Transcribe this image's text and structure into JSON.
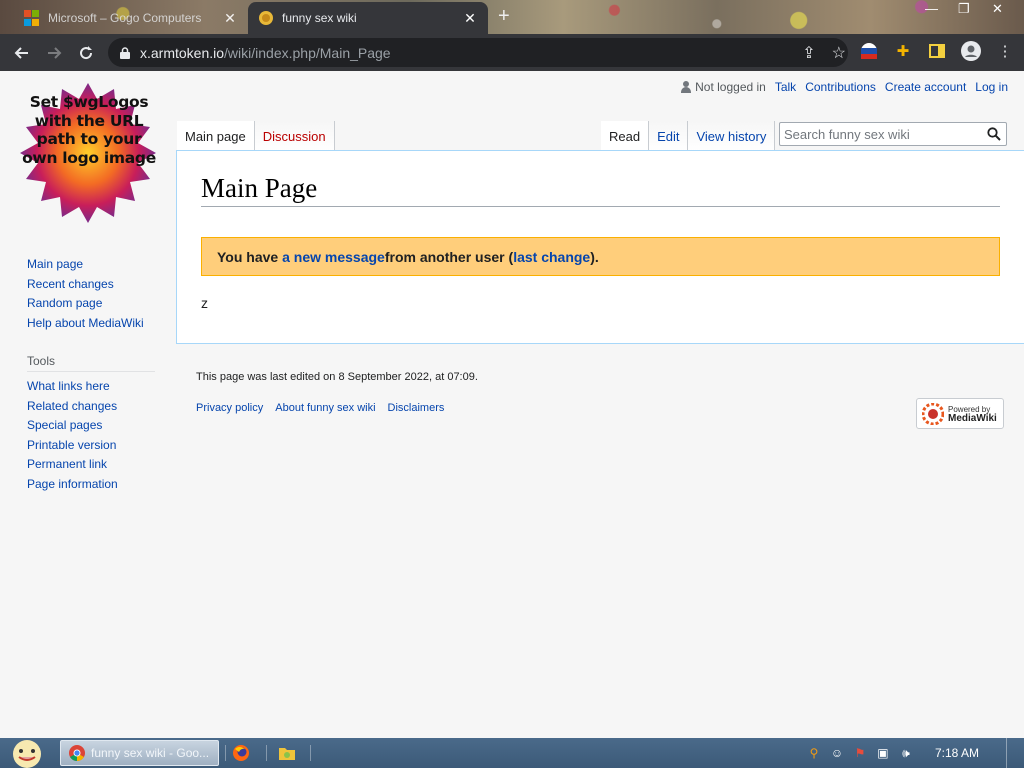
{
  "browser": {
    "tabs": [
      {
        "title": "Microsoft – Gogo Computers",
        "active": false
      },
      {
        "title": "funny sex wiki",
        "active": true
      }
    ],
    "url_host": "x.armtoken.io",
    "url_path": "/wiki/index.php/Main_Page",
    "new_tab_label": "+",
    "close_glyph": "✕"
  },
  "wiki": {
    "logo_text": "Set $wgLogos with the URL path to your own logo image",
    "personal": {
      "status": "Not logged in",
      "links": [
        "Talk",
        "Contributions",
        "Create account",
        "Log in"
      ]
    },
    "namespace_tabs": [
      {
        "label": "Main page",
        "selected": true
      },
      {
        "label": "Discussion",
        "selected": false,
        "new": true
      }
    ],
    "view_tabs": [
      {
        "label": "Read",
        "selected": true
      },
      {
        "label": "Edit",
        "selected": false
      },
      {
        "label": "View history",
        "selected": false
      }
    ],
    "search": {
      "placeholder": "Search funny sex wiki"
    },
    "heading": "Main Page",
    "talk_message": {
      "prefix": "You have ",
      "link1": "a new message",
      "middle": " from another user (",
      "link2": "last change",
      "suffix": ")."
    },
    "body_text": "z",
    "navigation": [
      "Main page",
      "Recent changes",
      "Random page",
      "Help about MediaWiki"
    ],
    "tools_heading": "Tools",
    "tools": [
      "What links here",
      "Related changes",
      "Special pages",
      "Printable version",
      "Permanent link",
      "Page information"
    ],
    "footer": {
      "last_edited": "This page was last edited on 8 September 2022, at 07:09.",
      "links": [
        "Privacy policy",
        "About funny sex wiki",
        "Disclaimers"
      ],
      "powered_small": "Powered by",
      "powered_big": "MediaWiki"
    }
  },
  "taskbar": {
    "chrome_label": "funny sex wiki - Goo...",
    "clock": "7:18 AM"
  },
  "colors": {
    "link": "#0645ad",
    "new_link": "#ba0000",
    "talk_bg": "#ffce7b",
    "chrome_dark": "#35363a"
  }
}
